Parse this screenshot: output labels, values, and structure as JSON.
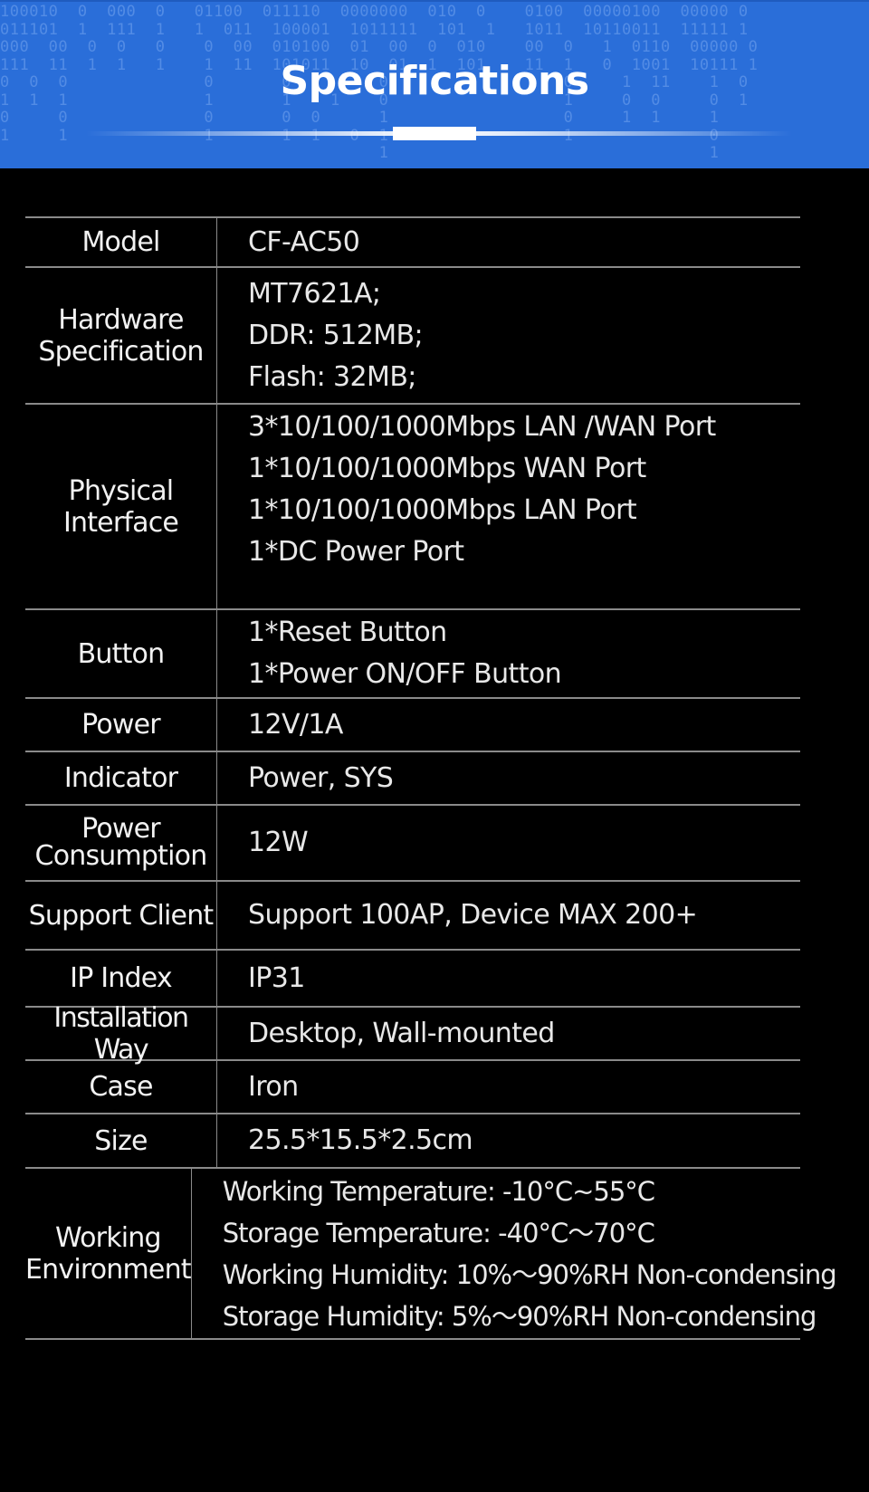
{
  "header": {
    "title": "Specifications",
    "background_color": "#2a6ed9",
    "binary_rows": [
      "100010  0  000  0   01100  011110  0000000  010  0    0100  00000100  00000 0",
      "011101  1  111  1   1  011  100001  1011111  101  1   1011  10110011  11111 1",
      "000  00  0  0   0    0  00  010100  01  00  0  010    00  0   1  0110  00000 0",
      "111  11  1  1   1    1  11  101011  10  01  1  101    11  1   0  1001  10111 1",
      "0  0  0              0       0         0                  0     1  11    1  0",
      "1  1  1              1       1    1    0                  1     0  0     0  1",
      "0     0              0       0  0      1                  0     1  1     1",
      "1     1              1       1  1   0  1                  1              0",
      "                                       1                                 1"
    ]
  },
  "specs": [
    {
      "label": "Model",
      "values": [
        "CF-AC50"
      ]
    },
    {
      "label": "Hardware Specification",
      "label_lines": [
        "Hardware",
        "Specification"
      ],
      "values": [
        "MT7621A;",
        "DDR: 512MB;",
        "Flash: 32MB;"
      ]
    },
    {
      "label": "Physical Interface",
      "label_lines": [
        "Physical",
        "Interface"
      ],
      "values": [
        "3*10/100/1000Mbps LAN /WAN Port",
        "1*10/100/1000Mbps WAN Port",
        "1*10/100/1000Mbps LAN Port",
        "1*DC Power Port"
      ]
    },
    {
      "label": "Button",
      "values": [
        "1*Reset Button",
        "1*Power ON/OFF Button"
      ]
    },
    {
      "label": "Power",
      "values": [
        "12V/1A"
      ]
    },
    {
      "label": "Indicator",
      "values": [
        "Power, SYS"
      ]
    },
    {
      "label": "Power Consumption",
      "label_lines": [
        "Power",
        "Consumption"
      ],
      "values": [
        "12W"
      ]
    },
    {
      "label": "Support Client",
      "values": [
        "Support 100AP, Device MAX 200+"
      ]
    },
    {
      "label": "IP Index",
      "values": [
        "IP31"
      ]
    },
    {
      "label": "Installation Way",
      "values": [
        "Desktop, Wall-mounted"
      ]
    },
    {
      "label": "Case",
      "values": [
        "Iron"
      ]
    },
    {
      "label": "Size",
      "values": [
        "25.5*15.5*2.5cm"
      ]
    },
    {
      "label": "Working Environment",
      "label_lines": [
        "Working",
        "Environment"
      ],
      "values": [
        "Working Temperature: -10°C~55°C",
        "Storage Temperature: -40°C～70°C",
        "Working Humidity: 10%～90%RH Non-condensing",
        "Storage Humidity: 5%～90%RH Non-condensing"
      ]
    }
  ]
}
